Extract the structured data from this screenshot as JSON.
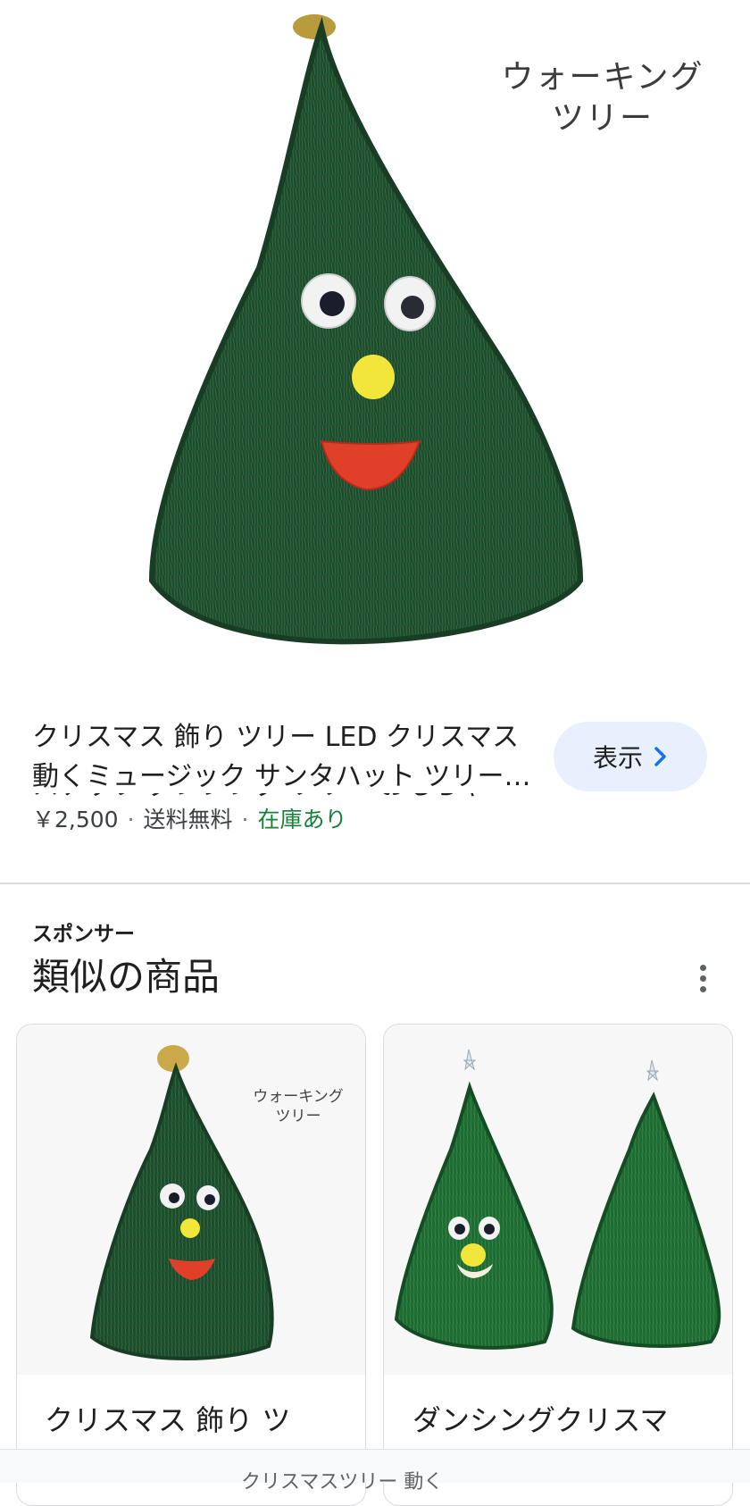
{
  "hero": {
    "caption_line1": "ウォーキング",
    "caption_line2": "ツリー"
  },
  "product": {
    "title": "クリスマス 飾り ツリー LED クリスマス 動くミュージック サンタハット ツリー…",
    "overflow_text": "ステップ ダンシング ツリー おもちゃ",
    "price": "￥2,500",
    "shipping": "送料無料",
    "stock": "在庫あり",
    "separator": "·"
  },
  "view_button": {
    "label": "表示",
    "icon": "chevron-right-icon"
  },
  "section": {
    "sponsor": "スポンサー",
    "title": "類似の商品",
    "more_icon": "more-vert-icon"
  },
  "cards": [
    {
      "title": "クリスマス 飾り ツ",
      "caption_line1": "ウォーキング",
      "caption_line2": "ツリー"
    },
    {
      "title": "ダンシングクリスマ"
    }
  ],
  "bottom_bar": {
    "query": "クリスマスツリー 動く"
  },
  "colors": {
    "accent": "#1a73e8",
    "stock": "#188038",
    "button_bg": "#e8f0fe",
    "tree_green": "#1f4a2c"
  }
}
